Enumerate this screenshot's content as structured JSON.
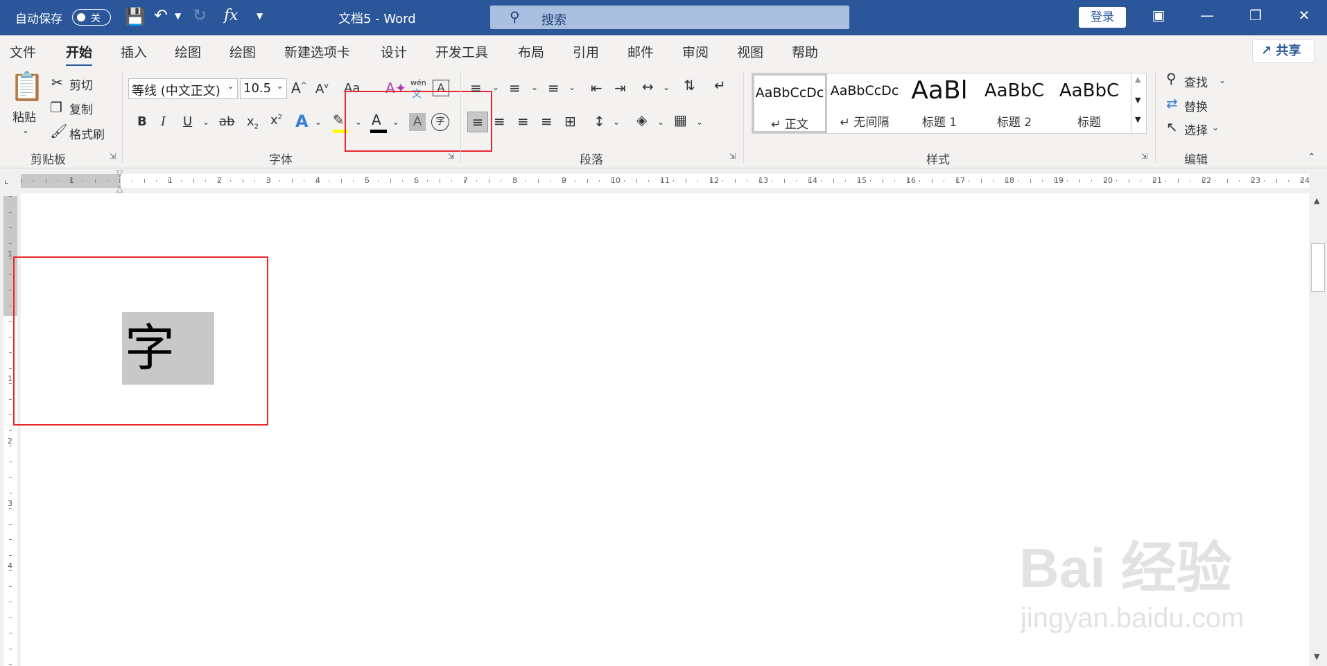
{
  "titlebar": {
    "autosave_label": "自动保存",
    "autosave_state": "关",
    "doc_title": "文档5  -  Word",
    "search_placeholder": "搜索",
    "login_label": "登录",
    "fx_label": "fx"
  },
  "tabs": [
    "文件",
    "开始",
    "插入",
    "绘图",
    "绘图",
    "新建选项卡",
    "设计",
    "开发工具",
    "布局",
    "引用",
    "邮件",
    "审阅",
    "视图",
    "帮助"
  ],
  "active_tab": "开始",
  "share_label": "共享",
  "clipboard": {
    "paste_label": "粘贴",
    "cut_label": "剪切",
    "copy_label": "复制",
    "format_painter_label": "格式刷",
    "group_label": "剪贴板"
  },
  "font": {
    "font_name": "等线 (中文正文)",
    "font_size": "10.5",
    "group_label": "字体",
    "phonetic_label": "wén",
    "enclose_glyph": "字"
  },
  "paragraph": {
    "group_label": "段落"
  },
  "styles": {
    "group_label": "样式",
    "items": [
      {
        "preview": "AaBbCcDc",
        "name": "↵ 正文"
      },
      {
        "preview": "AaBbCcDc",
        "name": "↵ 无间隔"
      },
      {
        "preview": "AaBl",
        "name": "标题 1"
      },
      {
        "preview": "AaBbC",
        "name": "标题 2"
      },
      {
        "preview": "AaBbC",
        "name": "标题"
      }
    ]
  },
  "editing": {
    "find_label": "查找",
    "replace_label": "替换",
    "select_label": "选择",
    "group_label": "编辑"
  },
  "ruler": {
    "h_numbers": [
      "1",
      "1",
      "2",
      "3",
      "4",
      "5",
      "6",
      "7",
      "8",
      "9",
      "10",
      "11",
      "12",
      "13",
      "14",
      "15",
      "16",
      "17",
      "18",
      "19",
      "20",
      "21",
      "22",
      "23",
      "24"
    ],
    "v_numbers": [
      "1",
      "1",
      "2",
      "3",
      "4"
    ]
  },
  "document": {
    "character": "字"
  },
  "watermark": {
    "line1": "Bai  经验",
    "line2": "jingyan.baidu.com"
  },
  "colors": {
    "titlebar": "#2b579a",
    "highlight": "#ffff00",
    "font_color": "#000000",
    "annotation_red": "#e8262b"
  }
}
